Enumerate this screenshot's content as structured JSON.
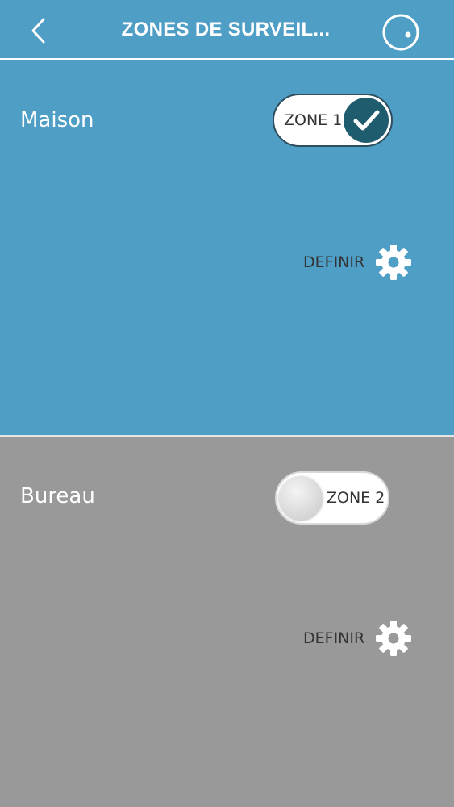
{
  "header": {
    "title": "ZONES DE SURVEIL...",
    "back_icon": "chevron-left-icon",
    "locate_icon": "locate-icon"
  },
  "zones": [
    {
      "name": "Maison",
      "toggle_label": "ZONE 1",
      "enabled": true,
      "define_label": "DEFINIR",
      "background": "#4f9ec5"
    },
    {
      "name": "Bureau",
      "toggle_label": "ZONE 2",
      "enabled": false,
      "define_label": "DEFINIR",
      "background": "#999999"
    }
  ],
  "colors": {
    "accent": "#4f9ec5",
    "toggle_on_knob": "#1f5c6e",
    "disabled_bg": "#999999"
  }
}
